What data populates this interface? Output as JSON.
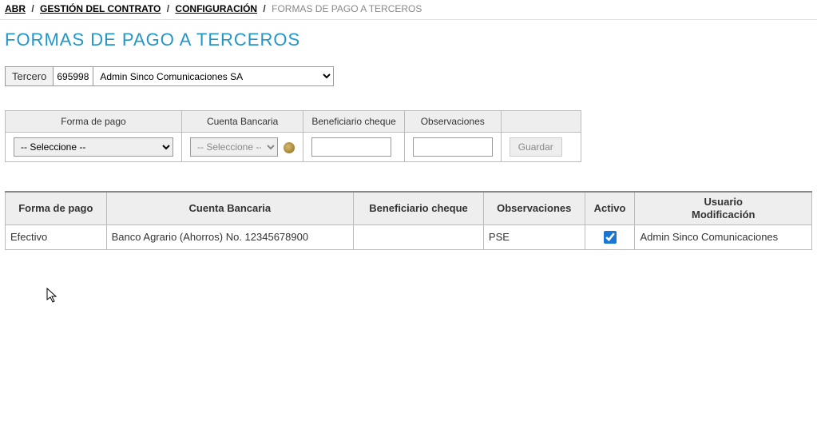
{
  "breadcrumb": {
    "items": [
      "ABR",
      "GESTIÓN DEL CONTRATO",
      "CONFIGURACIÓN"
    ],
    "current": "FORMAS DE PAGO A TERCEROS"
  },
  "page_title": "FORMAS DE PAGO A TERCEROS",
  "tercero": {
    "label": "Tercero",
    "code": "695998",
    "select_options": [
      "Admin Sinco Comunicaciones SA"
    ],
    "selected": "Admin Sinco Comunicaciones SA"
  },
  "form": {
    "headers": {
      "forma_pago": "Forma de pago",
      "cuenta": "Cuenta Bancaria",
      "beneficiario": "Beneficiario cheque",
      "observaciones": "Observaciones"
    },
    "forma_pago_placeholder": "-- Seleccione --",
    "cuenta_placeholder": "-- Seleccione --",
    "guardar_label": "Guardar"
  },
  "data_table": {
    "headers": {
      "forma_pago": "Forma de pago",
      "cuenta": "Cuenta Bancaria",
      "beneficiario": "Beneficiario cheque",
      "observaciones": "Observaciones",
      "activo": "Activo",
      "usuario_l1": "Usuario",
      "usuario_l2": "Modificación"
    },
    "rows": [
      {
        "forma_pago": "Efectivo",
        "cuenta": "Banco Agrario (Ahorros) No. 12345678900",
        "beneficiario": "",
        "observaciones": "PSE",
        "activo": true,
        "usuario": "Admin Sinco Comunicaciones"
      }
    ]
  }
}
